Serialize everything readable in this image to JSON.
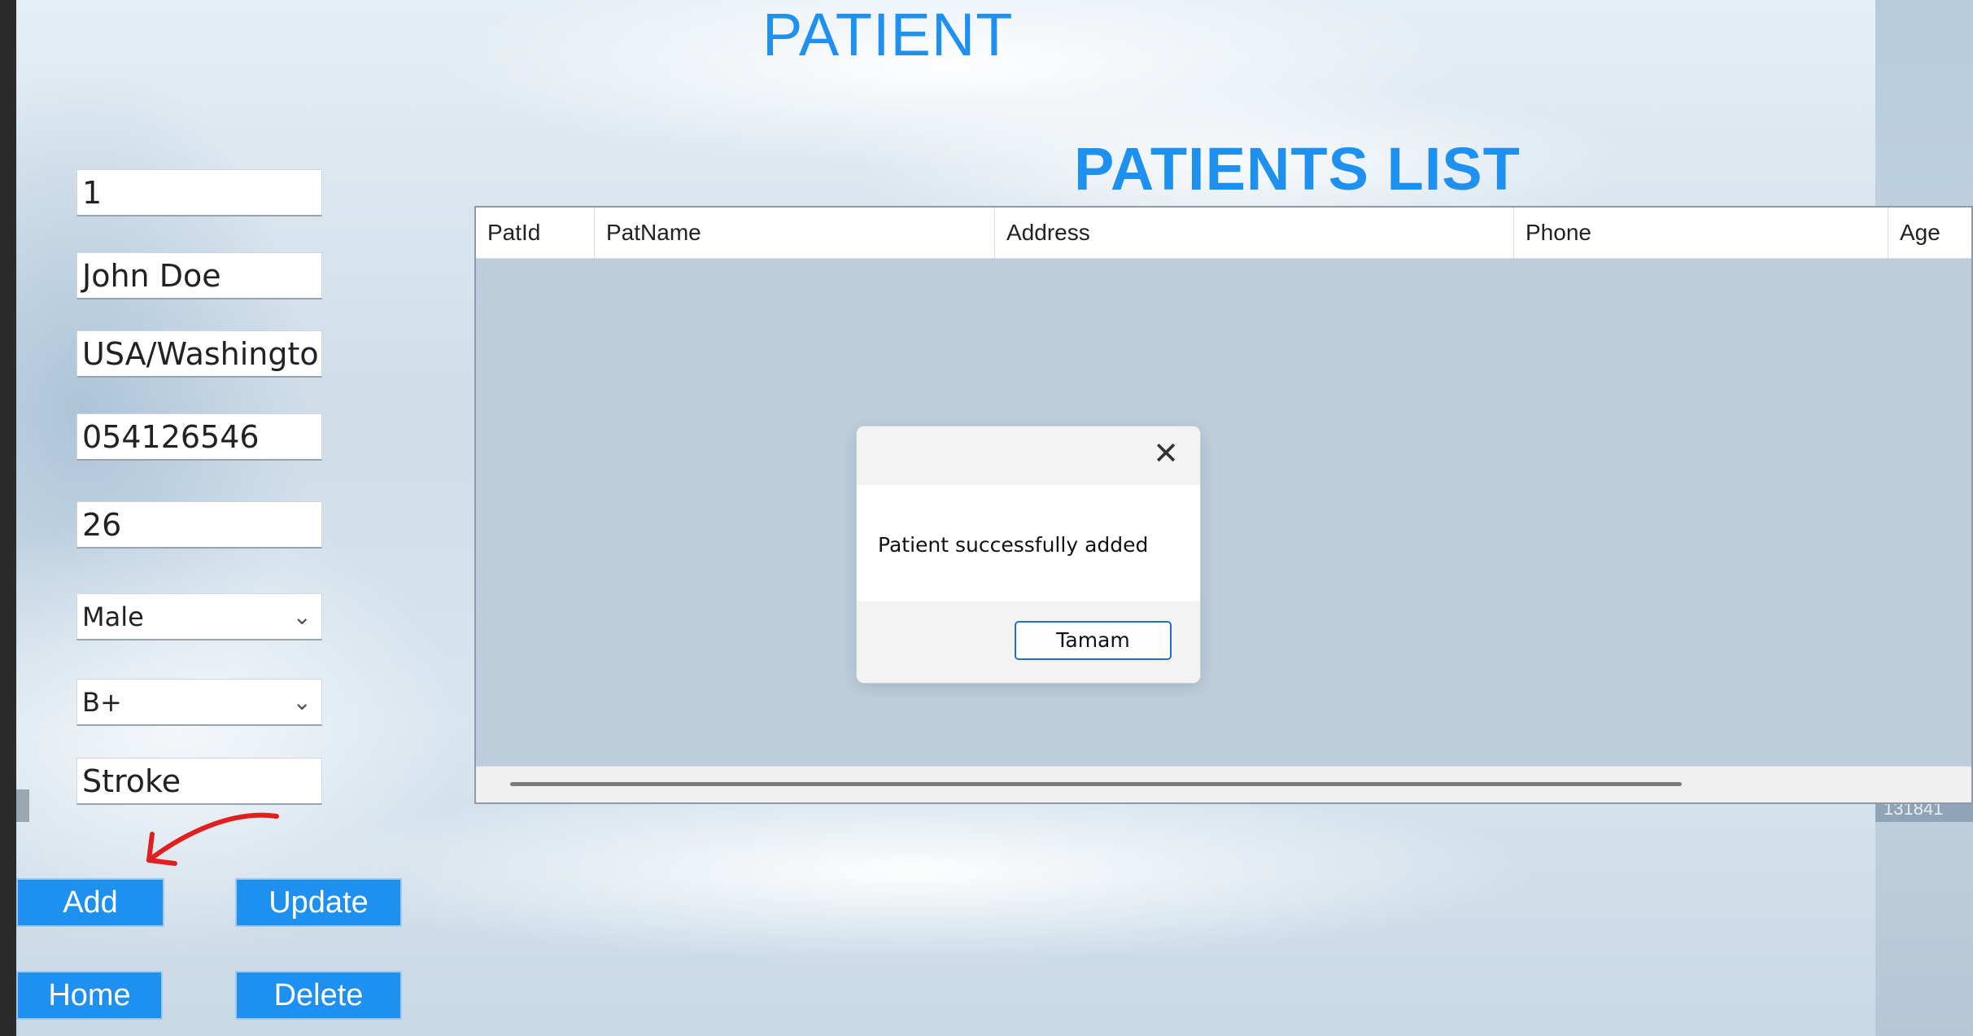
{
  "form": {
    "title": "PATIENT",
    "fields": {
      "id": "1",
      "name": "John Doe",
      "address": "USA/Washingto",
      "phone": "054126546",
      "age": "26",
      "gender": "Male",
      "blood_group": "B+",
      "disease": "Stroke"
    },
    "buttons": {
      "add": "Add",
      "update": "Update",
      "home": "Home",
      "delete": "Delete"
    }
  },
  "list": {
    "title": "PATIENTS LIST",
    "columns": [
      "PatId",
      "PatName",
      "Address",
      "Phone",
      "Age"
    ]
  },
  "dialog": {
    "message": "Patient successfully added",
    "ok_label": "Tamam",
    "close_icon": "close-icon"
  },
  "background_strip_label": "131841",
  "colors": {
    "accent": "#1e90f0",
    "annotation": "#e02020"
  }
}
